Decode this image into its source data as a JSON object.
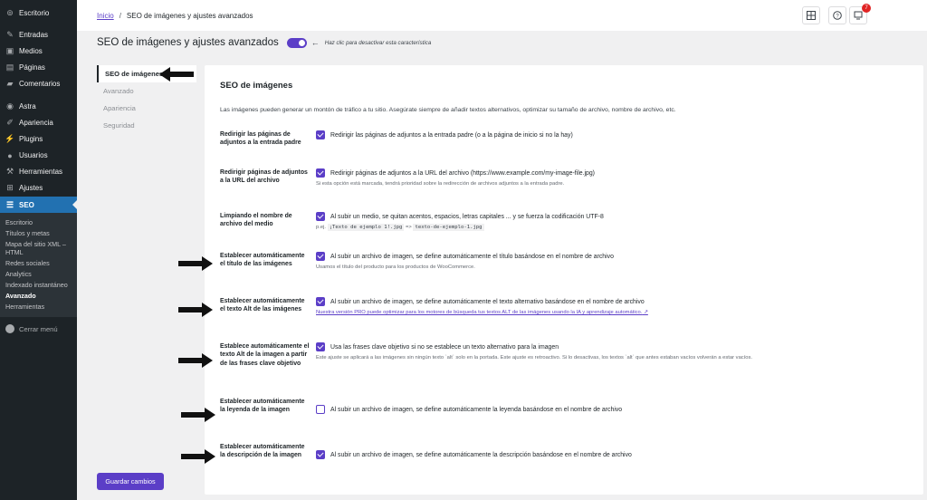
{
  "sidebar": {
    "items": [
      {
        "label": "Escritorio",
        "icon": "dashboard-icon",
        "glyph": "⊚"
      },
      {
        "label": "Entradas",
        "icon": "pin-icon",
        "glyph": "✎"
      },
      {
        "label": "Medios",
        "icon": "media-icon",
        "glyph": "▣"
      },
      {
        "label": "Páginas",
        "icon": "pages-icon",
        "glyph": "▤"
      },
      {
        "label": "Comentarios",
        "icon": "comments-icon",
        "glyph": "▰"
      },
      {
        "label": "Astra",
        "icon": "astra-icon",
        "glyph": "◉"
      },
      {
        "label": "Apariencia",
        "icon": "brush-icon",
        "glyph": "✐"
      },
      {
        "label": "Plugins",
        "icon": "plugin-icon",
        "glyph": "⚡"
      },
      {
        "label": "Usuarios",
        "icon": "users-icon",
        "glyph": "●"
      },
      {
        "label": "Herramientas",
        "icon": "wrench-icon",
        "glyph": "⚒"
      },
      {
        "label": "Ajustes",
        "icon": "settings-icon",
        "glyph": "⊞"
      },
      {
        "label": "SEO",
        "icon": "seo-icon",
        "glyph": "☰"
      }
    ],
    "submenu": [
      "Escritorio",
      "Títulos y metas",
      "Mapa del sitio XML – HTML",
      "Redes sociales",
      "Analytics",
      "Indexado instantáneo",
      "Avanzado",
      "Herramientas"
    ],
    "collapse": "Cerrar menú"
  },
  "header": {
    "breadcrumb_home": "Inicio",
    "breadcrumb_sep": "/",
    "breadcrumb_current": "SEO de imágenes y ajustes avanzados",
    "notifications_count": "7"
  },
  "page": {
    "title": "SEO de imágenes y ajustes avanzados",
    "toggle_hint": "Haz clic para desactivar esta característica"
  },
  "subnav": [
    "SEO de imágenes",
    "Avanzado",
    "Apariencia",
    "Seguridad"
  ],
  "save_label": "Guardar cambios",
  "panel": {
    "title": "SEO de imágenes",
    "intro": "Las imágenes pueden generar un montón de tráfico a tu sitio. Asegúrate siempre de añadir textos alternativos, optimizar su tamaño de archivo, nombre de archivo, etc.",
    "rows": [
      {
        "label": "Redirigir las páginas de adjuntos a la entrada padre",
        "text": "Redirigir las páginas de adjuntos a la entrada padre (o a la página de inicio si no la hay)",
        "checked": true
      },
      {
        "label": "Redirigir páginas de adjuntos a la URL del archivo",
        "text": "Redirigir páginas de adjuntos a la URL del archivo (https://www.example.com/my-image-file.jpg)",
        "desc": "Si esta opción está marcada, tendrá prioridad sobre la redirección de archivos adjuntos a la entrada padre.",
        "checked": true
      },
      {
        "label": "Limpiando el nombre de archivo del medio",
        "text": "Al subir un medio, se quitan acentos, espacios, letras capitales ... y se fuerza la codificación UTF-8",
        "desc_prefix": "p.ej.",
        "code1": "¡Texto de ejemplo 1!.jpg",
        "arrow_text": "=>",
        "code2": "texto-de-ejemplo-1.jpg",
        "checked": true
      },
      {
        "label": "Establecer automáticamente el título de las imágenes",
        "text": "Al subir un archivo de imagen, se define automáticamente el título basándose en el nombre de archivo",
        "desc": "Usamos el título del producto para los productos de WooCommerce.",
        "checked": true
      },
      {
        "label": "Establecer automáticamente el texto Alt de las imágenes",
        "text": "Al subir un archivo de imagen, se define automáticamente el texto alternativo basándose en el nombre de archivo",
        "link": "Nuestra versión PRO puede optimizar para los motores de búsqueda tus textos ALT de las imágenes usando la IA y aprendizaje automático.",
        "checked": true
      },
      {
        "label": "Establece automáticamente el texto Alt de la imagen a partir de las frases clave objetivo",
        "text": "Usa las frases clave objetivo si no se establece un texto alternativo para la imagen",
        "desc": "Este ajuste se aplicará a las imágenes sin ningún texto `alt` solo en la portada. Este ajuste es retroactivo. Si lo desactivas, los textos `alt` que antes estaban vacíos volverán a estar vacíos.",
        "checked": true
      },
      {
        "label": "Establecer automáticamente la leyenda de la imagen",
        "text": "Al subir un archivo de imagen, se define automáticamente la leyenda basándose en el nombre de archivo",
        "checked": false
      },
      {
        "label": "Establecer automáticamente la descripción de la imagen",
        "text": "Al subir un archivo de imagen, se define automáticamente la descripción basándose en el nombre de archivo",
        "checked": true
      }
    ]
  },
  "colors": {
    "accent": "#5b3ec7",
    "sidebar_bg": "#1d2327",
    "active_menu": "#2271b1"
  }
}
